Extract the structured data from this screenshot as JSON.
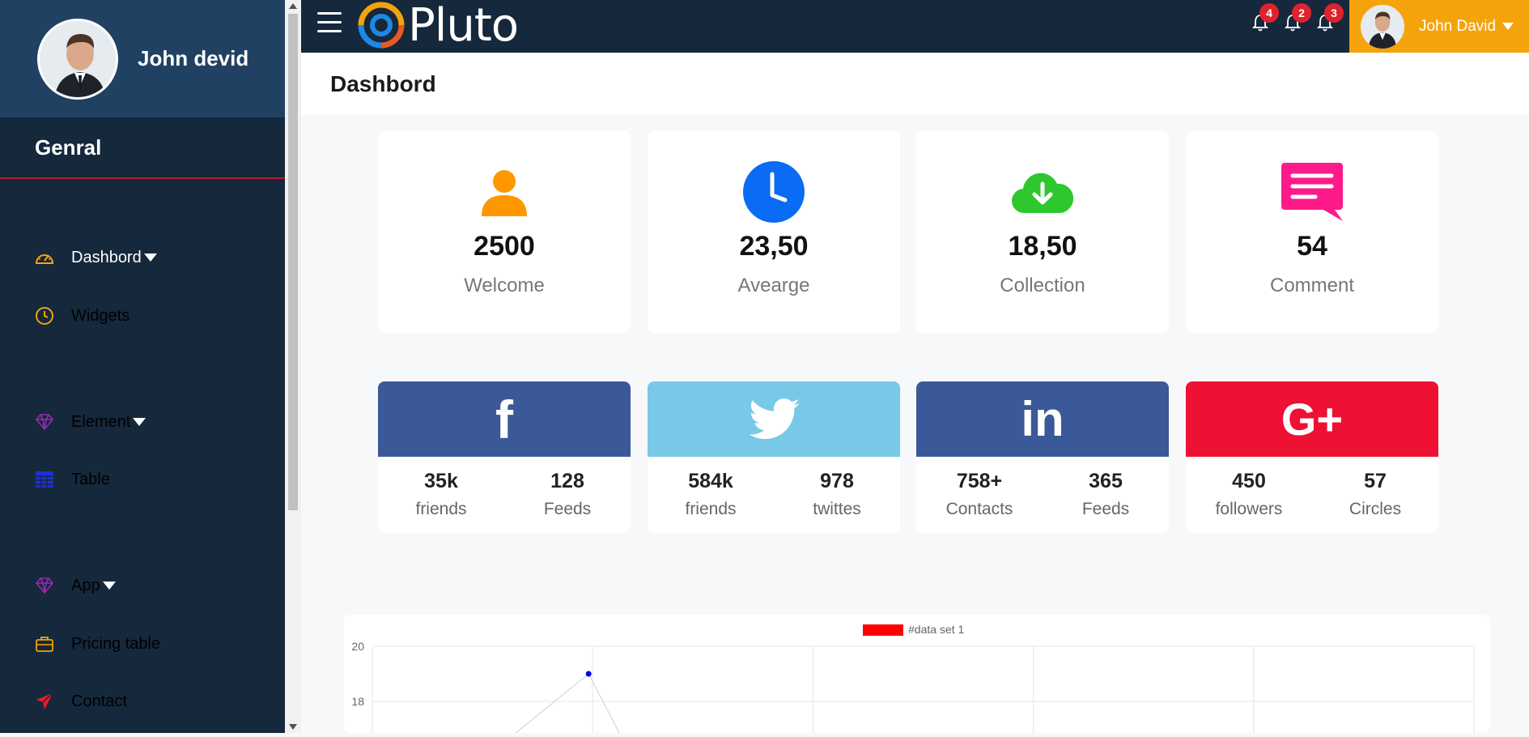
{
  "sidebar": {
    "profile_name": "John devid",
    "section_title": "Genral",
    "items": [
      {
        "label": "Dashbord",
        "icon": "dashboard-icon",
        "has_caret": true
      },
      {
        "label": "Widgets",
        "icon": "clock-icon",
        "has_caret": false
      },
      {
        "label": "Element",
        "icon": "diamond-icon",
        "has_caret": true
      },
      {
        "label": "Table",
        "icon": "table-icon",
        "has_caret": false
      },
      {
        "label": "App",
        "icon": "diamond-icon",
        "has_caret": true
      },
      {
        "label": "Pricing table",
        "icon": "briefcase-icon",
        "has_caret": false
      },
      {
        "label": "Contact",
        "icon": "paper-plane-icon",
        "has_caret": false
      }
    ]
  },
  "topbar": {
    "logo_text": "Pluto",
    "notifications": [
      {
        "icon": "bell-icon",
        "count": "4"
      },
      {
        "icon": "bell-icon",
        "count": "2"
      },
      {
        "icon": "bell-icon",
        "count": "3"
      }
    ],
    "user_name": "John David"
  },
  "page": {
    "title": "Dashbord"
  },
  "stats": [
    {
      "icon": "user-icon",
      "value": "2500",
      "label": "Welcome",
      "color": "#ff9800"
    },
    {
      "icon": "clock-icon",
      "value": "23,50",
      "label": "Avearge",
      "color": "#0a6cf5"
    },
    {
      "icon": "cloud-download-icon",
      "value": "18,50",
      "label": "Collection",
      "color": "#2ec72e"
    },
    {
      "icon": "comment-icon",
      "value": "54",
      "label": "Comment",
      "color": "#ff1a8c"
    }
  ],
  "social": [
    {
      "icon": "facebook-icon",
      "glyph": "f",
      "color": "#3b5998",
      "stats": [
        {
          "value": "35k",
          "label": "friends"
        },
        {
          "value": "128",
          "label": "Feeds"
        }
      ]
    },
    {
      "icon": "twitter-icon",
      "glyph": "",
      "color": "#78c9e8",
      "stats": [
        {
          "value": "584k",
          "label": "friends"
        },
        {
          "value": "978",
          "label": "twittes"
        }
      ]
    },
    {
      "icon": "linkedin-icon",
      "glyph": "in",
      "color": "#3b5998",
      "stats": [
        {
          "value": "758+",
          "label": "Contacts"
        },
        {
          "value": "365",
          "label": "Feeds"
        }
      ]
    },
    {
      "icon": "google-plus-icon",
      "glyph": "G+",
      "color": "#ee1133",
      "stats": [
        {
          "value": "450",
          "label": "followers"
        },
        {
          "value": "57",
          "label": "Circles"
        }
      ]
    }
  ],
  "chart_data": {
    "type": "line",
    "series": [
      {
        "name": "#data set 1",
        "color": "#ff0000"
      }
    ],
    "y_ticks": [
      "20",
      "18"
    ],
    "visible_points": [
      {
        "x": 2,
        "y": 19
      }
    ],
    "grid": true,
    "legend": "top-center"
  }
}
